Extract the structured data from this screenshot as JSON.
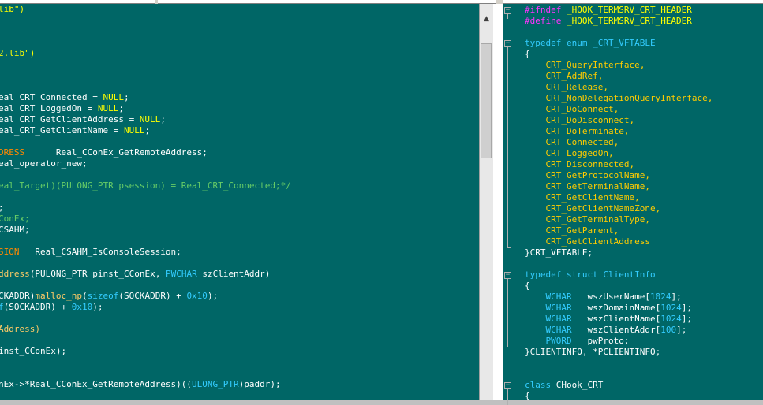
{
  "colors": {
    "bg": "#006666",
    "default": "#ffffff",
    "keyword": "#33ccff",
    "preprocessor": "#ff33ff",
    "string": "#ffff00",
    "type": "#ff8800",
    "function": "#ffcc66",
    "comment": "#66cc66",
    "number": "#33ccff",
    "enum": "#ffcc00"
  },
  "left_editor": {
    "lines": [
      [
        {
          "t": "lib\")",
          "c": "string"
        }
      ],
      [],
      [],
      [],
      [
        {
          "t": "2.lib\")",
          "c": "string"
        }
      ],
      [],
      [],
      [],
      [
        {
          "t": "eal_CRT_Connected = ",
          "c": "default"
        },
        {
          "t": "NULL",
          "c": "string"
        },
        {
          "t": ";",
          "c": "default"
        }
      ],
      [
        {
          "t": "eal_CRT_LoggedOn = ",
          "c": "default"
        },
        {
          "t": "NULL",
          "c": "string"
        },
        {
          "t": ";",
          "c": "default"
        }
      ],
      [
        {
          "t": "eal_CRT_GetClientAddress = ",
          "c": "default"
        },
        {
          "t": "NULL",
          "c": "string"
        },
        {
          "t": ";",
          "c": "default"
        }
      ],
      [
        {
          "t": "eal_CRT_GetClientName = ",
          "c": "default"
        },
        {
          "t": "NULL",
          "c": "string"
        },
        {
          "t": ";",
          "c": "default"
        }
      ],
      [],
      [
        {
          "t": "DRESS",
          "c": "type"
        },
        {
          "t": "      Real_CConEx_GetRemoteAddress;",
          "c": "default"
        }
      ],
      [
        {
          "t": "eal_operator_new;",
          "c": "default"
        }
      ],
      [],
      [
        {
          "t": "eal_Target)(PULONG_PTR psession) = Real_CRT_Connected;*/",
          "c": "comment"
        }
      ],
      [],
      [
        {
          "t": ";",
          "c": "default"
        }
      ],
      [
        {
          "t": "ConEx;",
          "c": "comment"
        }
      ],
      [
        {
          "t": "CSAHM;",
          "c": "default"
        }
      ],
      [],
      [
        {
          "t": "SION",
          "c": "type"
        },
        {
          "t": "   Real_CSAHM_IsConsoleSession;",
          "c": "default"
        }
      ],
      [],
      [
        {
          "t": "ddress",
          "c": "function"
        },
        {
          "t": "(PULONG_PTR",
          "c": "default"
        },
        {
          "t": " pinst_CConEx, ",
          "c": "default"
        },
        {
          "t": "PWCHAR",
          "c": "keyword"
        },
        {
          "t": " szClientAddr)",
          "c": "default"
        }
      ],
      [],
      [
        {
          "t": "CKADDR)",
          "c": "default"
        },
        {
          "t": "malloc_np",
          "c": "function"
        },
        {
          "t": "(",
          "c": "default"
        },
        {
          "t": "sizeof",
          "c": "keyword"
        },
        {
          "t": "(SOCKADDR) + ",
          "c": "default"
        },
        {
          "t": "0x10",
          "c": "number"
        },
        {
          "t": ");",
          "c": "default"
        }
      ],
      [
        {
          "t": "f",
          "c": "keyword"
        },
        {
          "t": "(SOCKADDR) + ",
          "c": "default"
        },
        {
          "t": "0x10",
          "c": "number"
        },
        {
          "t": ");",
          "c": "default"
        }
      ],
      [],
      [
        {
          "t": "Address)",
          "c": "function"
        }
      ],
      [],
      [
        {
          "t": "inst_CConEx);",
          "c": "default"
        }
      ],
      [],
      [],
      [
        {
          "t": "nEx->*Real_CConEx_GetRemoteAddress)((",
          "c": "default"
        },
        {
          "t": "ULONG_PTR",
          "c": "keyword"
        },
        {
          "t": ")paddr);",
          "c": "default"
        }
      ]
    ]
  },
  "right_editor": {
    "lines": [
      [
        {
          "t": "#ifndef",
          "c": "preprocessor"
        },
        {
          "t": " _HOOK_TERMSRV_CRT_HEADER",
          "c": "string"
        }
      ],
      [
        {
          "t": "#define",
          "c": "preprocessor"
        },
        {
          "t": " _HOOK_TERMSRV_CRT_HEADER",
          "c": "string"
        }
      ],
      [],
      [
        {
          "t": "typedef enum",
          "c": "keyword"
        },
        {
          "t": " _CRT_VFTABLE",
          "c": "keyword"
        }
      ],
      [
        {
          "t": "{",
          "c": "default"
        }
      ],
      [
        {
          "t": "    CRT_QueryInterface,",
          "c": "enum"
        }
      ],
      [
        {
          "t": "    CRT_AddRef,",
          "c": "enum"
        }
      ],
      [
        {
          "t": "    CRT_Release,",
          "c": "enum"
        }
      ],
      [
        {
          "t": "    CRT_NonDelegationQueryInterface,",
          "c": "enum"
        }
      ],
      [
        {
          "t": "    CRT_DoConnect,",
          "c": "enum"
        }
      ],
      [
        {
          "t": "    CRT_DoDisconnect,",
          "c": "enum"
        }
      ],
      [
        {
          "t": "    CRT_DoTerminate,",
          "c": "enum"
        }
      ],
      [
        {
          "t": "    CRT_Connected,",
          "c": "enum"
        }
      ],
      [
        {
          "t": "    CRT_LoggedOn,",
          "c": "enum"
        }
      ],
      [
        {
          "t": "    CRT_Disconnected,",
          "c": "enum"
        }
      ],
      [
        {
          "t": "    CRT_GetProtocolName,",
          "c": "enum"
        }
      ],
      [
        {
          "t": "    CRT_GetTerminalName,",
          "c": "enum"
        }
      ],
      [
        {
          "t": "    CRT_GetClientName,",
          "c": "enum"
        }
      ],
      [
        {
          "t": "    CRT_GetClientNameZone,",
          "c": "enum"
        }
      ],
      [
        {
          "t": "    CRT_GetTerminalType,",
          "c": "enum"
        }
      ],
      [
        {
          "t": "    CRT_GetParent,",
          "c": "enum"
        }
      ],
      [
        {
          "t": "    CRT_GetClientAddress",
          "c": "enum"
        }
      ],
      [
        {
          "t": "}CRT_VFTABLE;",
          "c": "default"
        }
      ],
      [],
      [
        {
          "t": "typedef struct",
          "c": "keyword"
        },
        {
          "t": " ClientInfo",
          "c": "keyword"
        }
      ],
      [
        {
          "t": "{",
          "c": "default"
        }
      ],
      [
        {
          "t": "    ",
          "c": "default"
        },
        {
          "t": "WCHAR",
          "c": "keyword"
        },
        {
          "t": "   wszUserName[",
          "c": "default"
        },
        {
          "t": "1024",
          "c": "number"
        },
        {
          "t": "];",
          "c": "default"
        }
      ],
      [
        {
          "t": "    ",
          "c": "default"
        },
        {
          "t": "WCHAR",
          "c": "keyword"
        },
        {
          "t": "   wszDomainName[",
          "c": "default"
        },
        {
          "t": "1024",
          "c": "number"
        },
        {
          "t": "];",
          "c": "default"
        }
      ],
      [
        {
          "t": "    ",
          "c": "default"
        },
        {
          "t": "WCHAR",
          "c": "keyword"
        },
        {
          "t": "   wszClientName[",
          "c": "default"
        },
        {
          "t": "1024",
          "c": "number"
        },
        {
          "t": "];",
          "c": "default"
        }
      ],
      [
        {
          "t": "    ",
          "c": "default"
        },
        {
          "t": "WCHAR",
          "c": "keyword"
        },
        {
          "t": "   wszClientAddr[",
          "c": "default"
        },
        {
          "t": "100",
          "c": "number"
        },
        {
          "t": "];",
          "c": "default"
        }
      ],
      [
        {
          "t": "    ",
          "c": "default"
        },
        {
          "t": "PWORD",
          "c": "keyword"
        },
        {
          "t": "   pwProto;",
          "c": "default"
        }
      ],
      [
        {
          "t": "}CLIENTINFO, *PCLIENTINFO;",
          "c": "default"
        }
      ],
      [],
      [],
      [
        {
          "t": "class",
          "c": "keyword"
        },
        {
          "t": " CHook_CRT",
          "c": "default"
        }
      ],
      [
        {
          "t": "{",
          "c": "default"
        }
      ]
    ]
  }
}
